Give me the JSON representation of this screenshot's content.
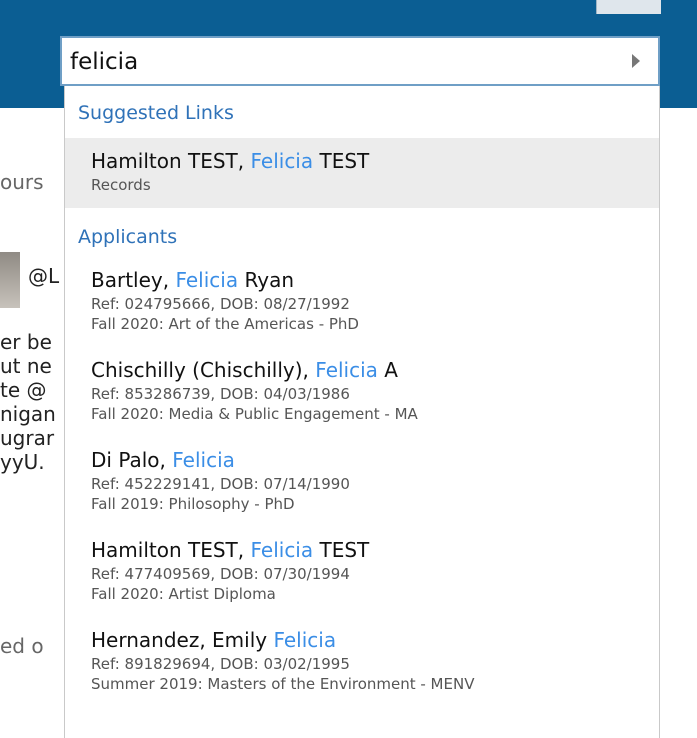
{
  "search": {
    "value": "felicia"
  },
  "background_fragments": [
    "ours",
    "@L",
    "er be",
    "ut ne",
    "te @",
    "nigan",
    "ugrar",
    "yyU.",
    "ed o"
  ],
  "dropdown": {
    "suggested_header": "Suggested Links",
    "suggested": [
      {
        "pre": "Hamilton TEST, ",
        "hit": "Felicia",
        "post": " TEST",
        "sub": "Records"
      }
    ],
    "applicants_header": "Applicants",
    "applicants": [
      {
        "pre": "Bartley, ",
        "hit": "Felicia",
        "post": " Ryan",
        "ref": "Ref: 024795666, DOB: 08/27/1992",
        "program": "Fall 2020: Art of the Americas - PhD"
      },
      {
        "pre": "Chischilly (Chischilly), ",
        "hit": "Felicia",
        "post": " A",
        "ref": "Ref: 853286739, DOB: 04/03/1986",
        "program": "Fall 2020: Media & Public Engagement - MA"
      },
      {
        "pre": "Di Palo, ",
        "hit": "Felicia",
        "post": "",
        "ref": "Ref: 452229141, DOB: 07/14/1990",
        "program": "Fall 2019: Philosophy - PhD"
      },
      {
        "pre": "Hamilton TEST, ",
        "hit": "Felicia",
        "post": " TEST",
        "ref": "Ref: 477409569, DOB: 07/30/1994",
        "program": "Fall 2020: Artist Diploma"
      },
      {
        "pre": "Hernandez, Emily ",
        "hit": "Felicia",
        "post": "",
        "ref": "Ref: 891829694, DOB: 03/02/1995",
        "program": "Summer 2019: Masters of the Environment - MENV"
      }
    ]
  },
  "colors": {
    "header_bar": "#0b5e93",
    "highlight": "#3b8ee6",
    "section_header": "#2f72b8",
    "hover_row": "#ececec"
  },
  "icons": {
    "submit": "triangle-right-icon"
  }
}
